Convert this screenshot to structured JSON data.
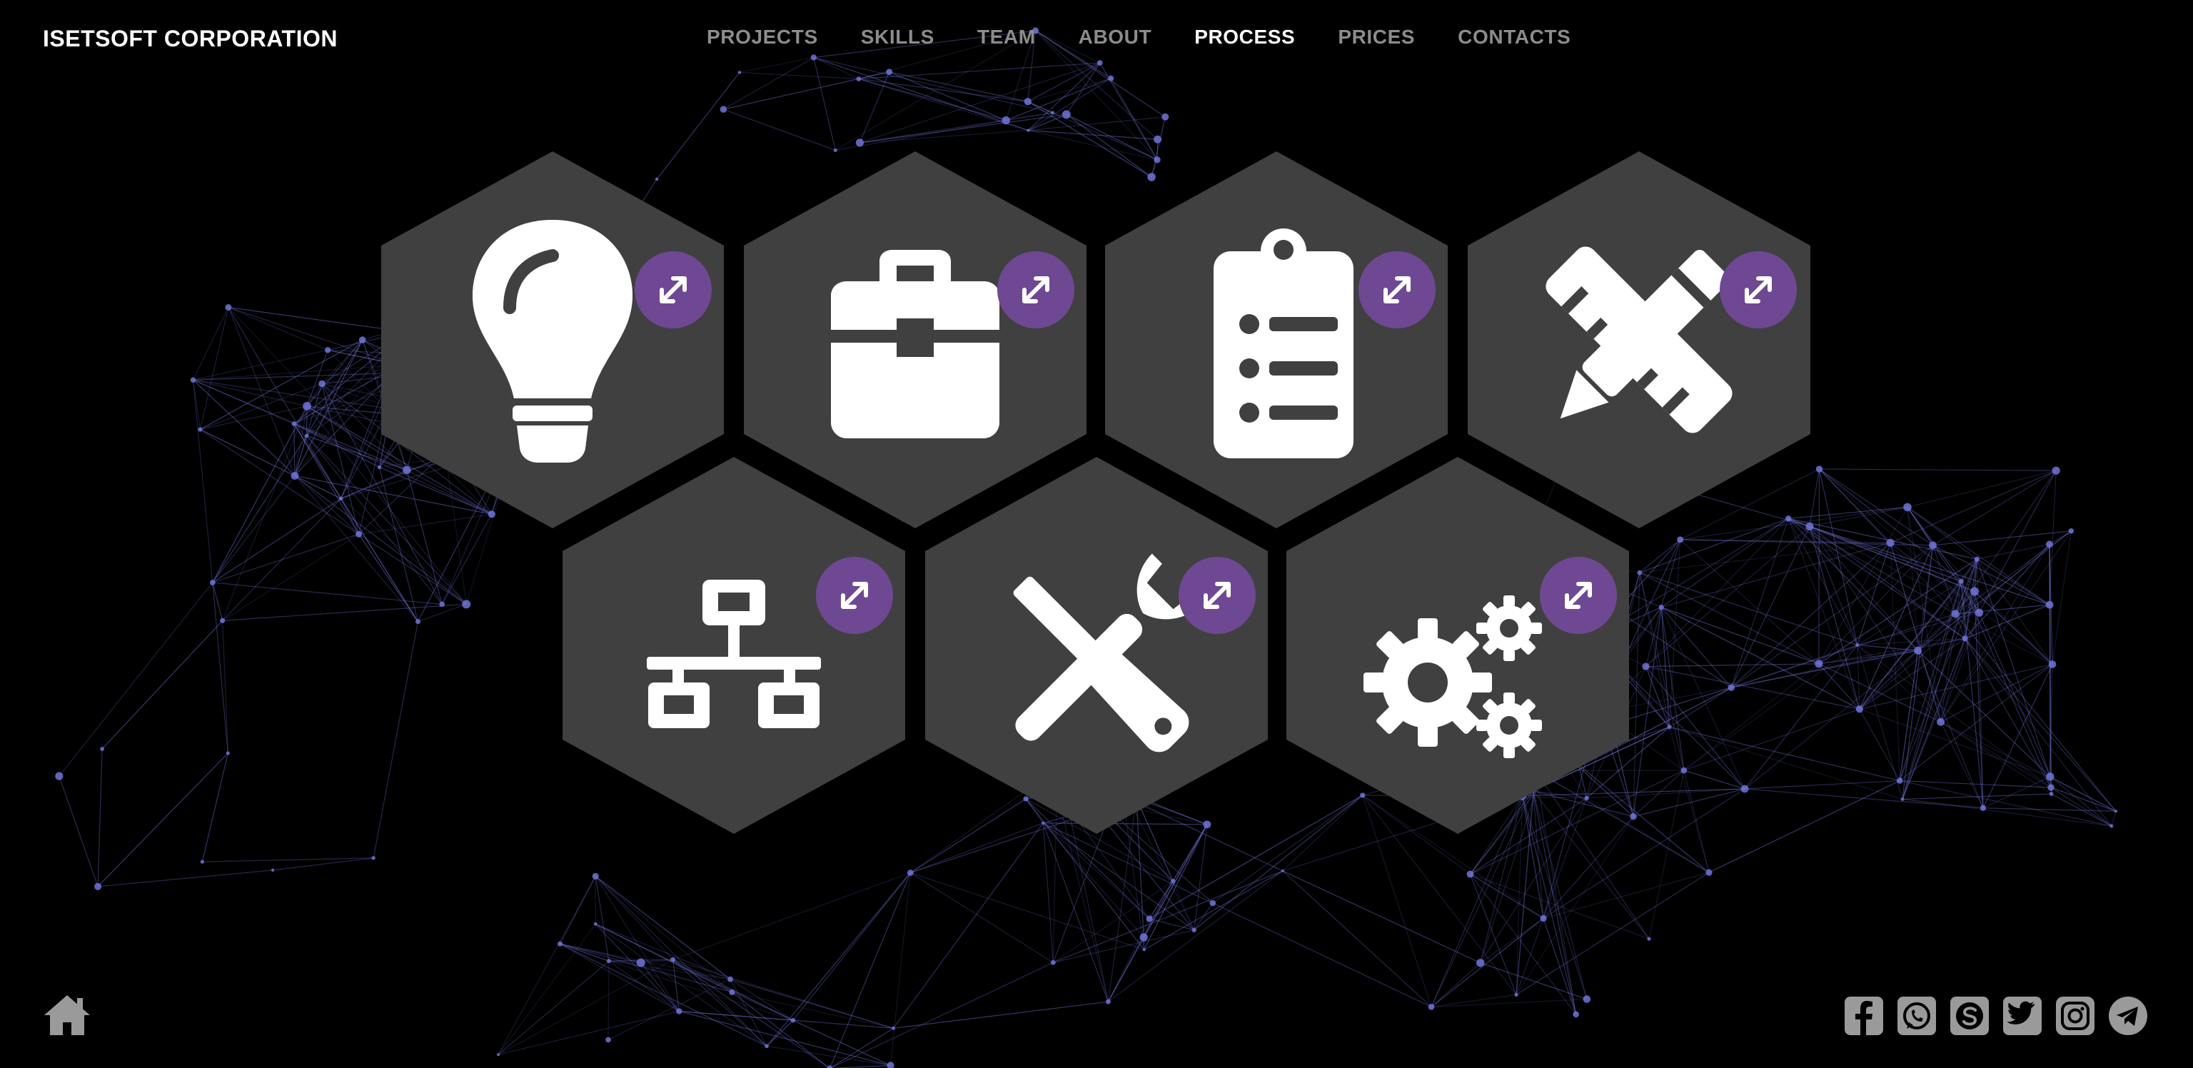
{
  "header": {
    "brand": "ISETSOFT CORPORATION",
    "nav": [
      {
        "label": "PROJECTS",
        "active": false
      },
      {
        "label": "SKILLS",
        "active": false
      },
      {
        "label": "TEAM",
        "active": false
      },
      {
        "label": "ABOUT",
        "active": false
      },
      {
        "label": "PROCESS",
        "active": true
      },
      {
        "label": "PRICES",
        "active": false
      },
      {
        "label": "CONTACTS",
        "active": false
      }
    ]
  },
  "process_steps": [
    {
      "icon": "lightbulb-icon"
    },
    {
      "icon": "briefcase-icon"
    },
    {
      "icon": "clipboard-list-icon"
    },
    {
      "icon": "pencil-ruler-icon"
    },
    {
      "icon": "network-icon"
    },
    {
      "icon": "tools-icon"
    },
    {
      "icon": "gears-icon"
    }
  ],
  "expand_icon": "expand-arrows-icon",
  "footer": {
    "home_icon": "home-icon",
    "social": [
      "facebook-icon",
      "whatsapp-icon",
      "skype-icon",
      "twitter-icon",
      "instagram-icon",
      "telegram-icon"
    ]
  },
  "colors": {
    "background": "#000000",
    "hexagon": "#404040",
    "badge": "#6f4893",
    "network_lines": "#6f74d8",
    "nav_inactive": "#8c8c8c",
    "nav_active": "#ffffff"
  }
}
